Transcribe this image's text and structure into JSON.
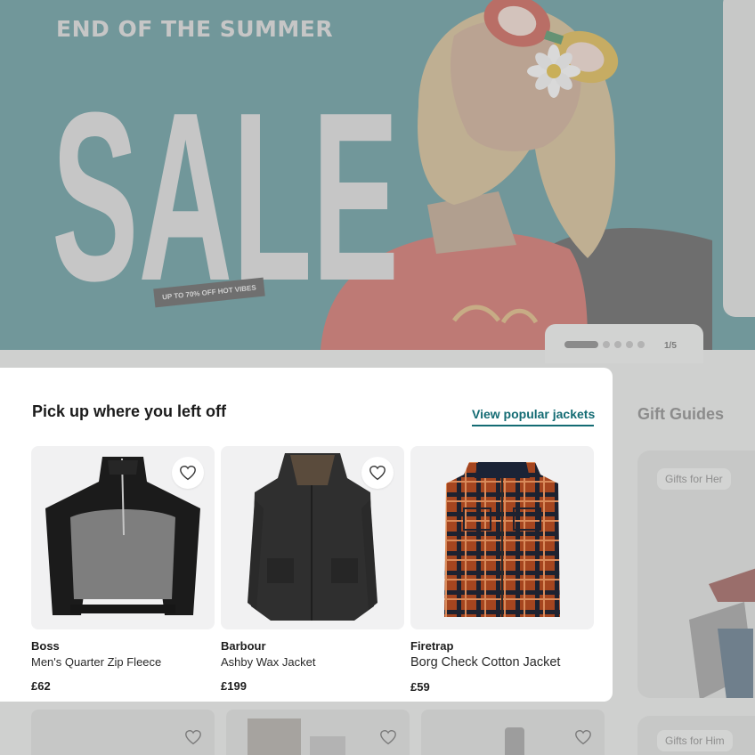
{
  "hero": {
    "headline": "END OF THE SUMMER",
    "big_word": "SALE",
    "tag": "UP TO 70% OFF HOT VIBES",
    "pager_count": "1/5"
  },
  "recent": {
    "title": "Pick up where you left off",
    "link": "View popular jackets",
    "products": [
      {
        "brand": "Boss",
        "name": "Men's Quarter Zip Fleece",
        "price": "£62"
      },
      {
        "brand": "Barbour",
        "name": "Ashby Wax Jacket",
        "price": "£199"
      },
      {
        "brand": "Firetrap",
        "name": "Borg Check Cotton Jacket",
        "price": "£59"
      }
    ]
  },
  "gifts": {
    "title": "Gift Guides",
    "items": [
      "Gifts for Her",
      "Gifts for Him"
    ]
  },
  "colors": {
    "accent": "#136b73",
    "hero_bg": "#5f9497",
    "overlay": "#cfd0cf"
  },
  "icons": [
    "heart-icon"
  ]
}
